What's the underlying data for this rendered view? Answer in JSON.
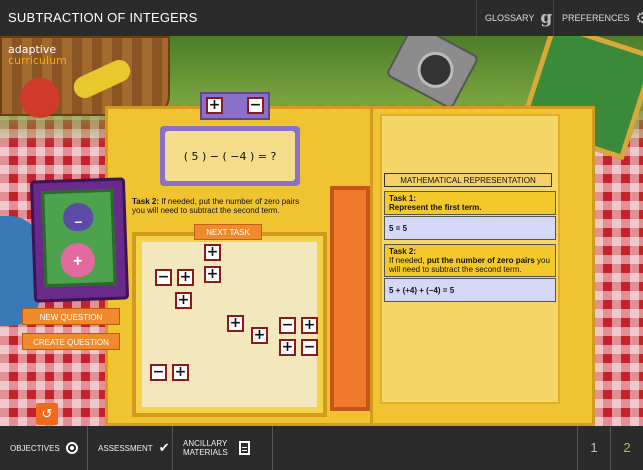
{
  "header": {
    "title": "SUBTRACTION OF INTEGERS",
    "glossary_label": "GLOSSARY",
    "preferences_label": "PREFERENCES",
    "glossary_icon": "g",
    "preferences_icon": "⚙"
  },
  "brand": {
    "line1": "adaptive",
    "line2": "curriculum"
  },
  "workspace": {
    "pair_tiles": [
      "+",
      "−"
    ],
    "expression": "( 5 ) − ( −4 ) = ?",
    "task2_prefix": "Task 2:",
    "task2_text": "If needed, put the number of zero pairs you will need to subtract the second term.",
    "next_task_label": "NEXT TASK",
    "tiles": [
      {
        "sign": "+",
        "name": "tile-plus"
      },
      {
        "sign": "+",
        "name": "tile-plus"
      },
      {
        "sign": "−",
        "name": "tile-minus"
      },
      {
        "sign": "+",
        "name": "tile-plus"
      },
      {
        "sign": "+",
        "name": "tile-plus"
      },
      {
        "sign": "+",
        "name": "tile-plus"
      },
      {
        "sign": "+",
        "name": "tile-plus"
      },
      {
        "sign": "−",
        "name": "tile-minus"
      },
      {
        "sign": "+",
        "name": "tile-plus"
      },
      {
        "sign": "+",
        "name": "tile-plus"
      },
      {
        "sign": "−",
        "name": "tile-minus"
      },
      {
        "sign": "−",
        "name": "tile-minus"
      },
      {
        "sign": "+",
        "name": "tile-plus"
      }
    ]
  },
  "math_panel": {
    "header": "MATHEMATICAL REPRESENTATION",
    "task1_title": "Task 1:",
    "task1_desc": "Represent the first term.",
    "task1_equation": "5 = 5",
    "task2_title": "Task 2:",
    "task2_desc_start": "If needed, ",
    "task2_desc_bold": "put the number of zero pairs",
    "task2_desc_end": " you will need to subtract the second term.",
    "task2_equation": "5 + (+4) + (−4) = 5"
  },
  "side_buttons": {
    "new_question": "NEW QUESTION",
    "create_question": "CREATE QUESTION",
    "refresh_icon": "↺"
  },
  "footer": {
    "objectives": "OBJECTIVES",
    "assessment": "ASSESSMENT",
    "ancillary": "ANCILLARY MATERIALS",
    "check_icon": "✔",
    "pages": [
      "1",
      "2"
    ]
  }
}
